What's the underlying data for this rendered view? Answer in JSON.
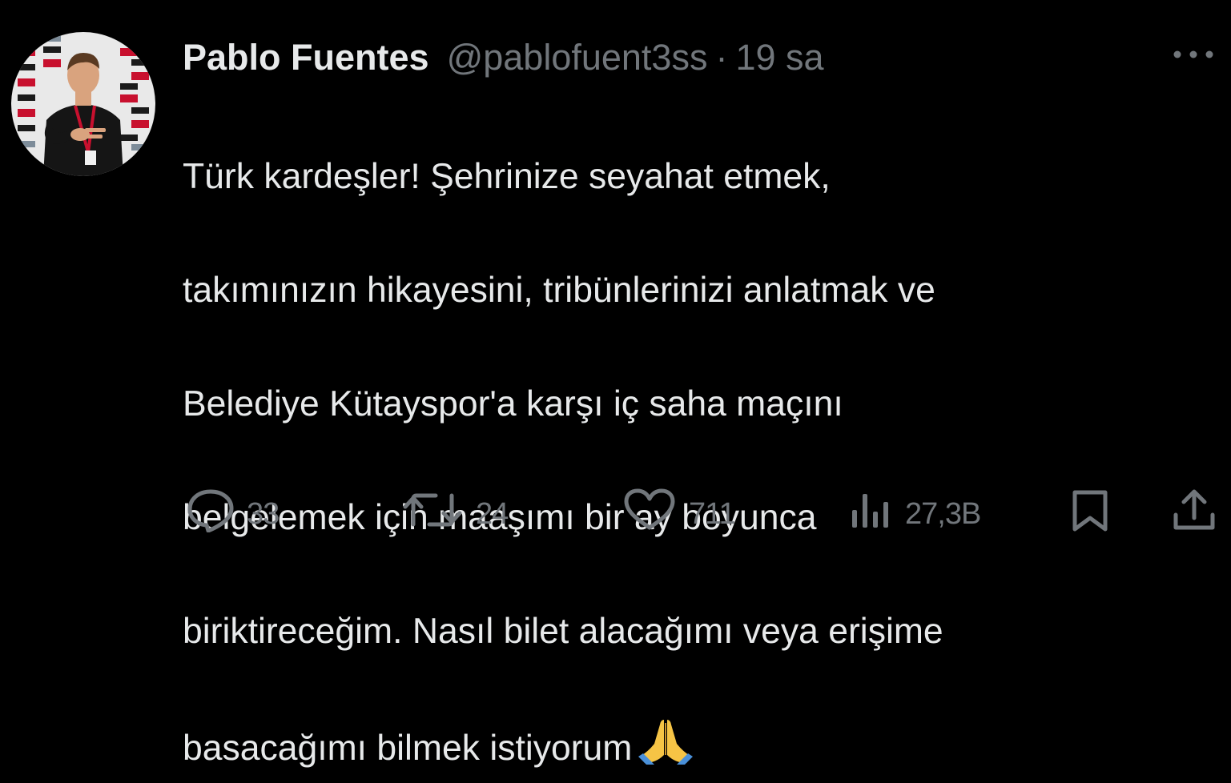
{
  "tweet": {
    "author_name": "Pablo Fuentes",
    "handle": "@pablofuent3ss",
    "separator": "·",
    "time": "19 sa",
    "text_lines": [
      "Türk kardeşler! Şehrinize seyahat etmek,",
      "takımınızın hikayesini, tribünlerinizi anlatmak ve",
      "Belediye Kütayspor'a karşı iç saha maçını",
      "belgelemek için maaşımı bir ay boyunca",
      "biriktireceğim. Nasıl bilet alacağımı veya erişime",
      "basacağımı bilmek istiyorum"
    ],
    "emoji": "folded-hands-icon"
  },
  "actions": {
    "replies": "33",
    "retweets": "24",
    "likes": "711",
    "views": "27,3B"
  },
  "colors": {
    "background": "#000000",
    "text": "#e7e9ea",
    "muted": "#71767b"
  }
}
